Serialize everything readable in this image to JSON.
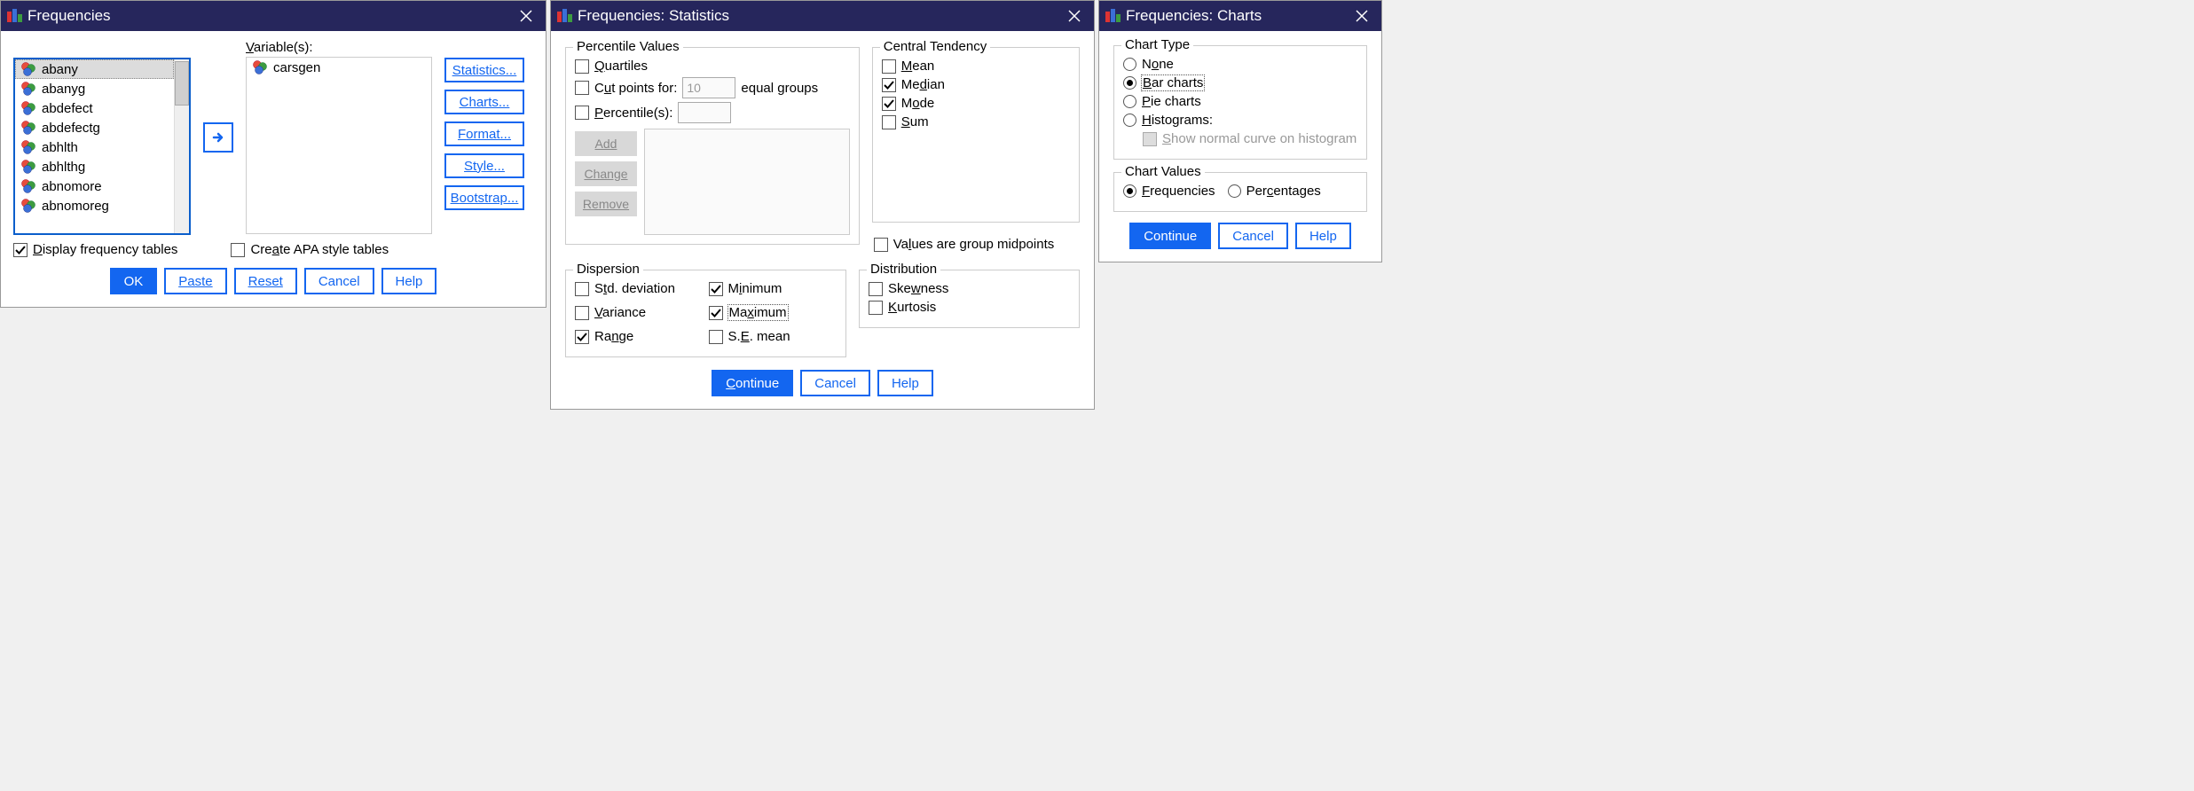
{
  "freq": {
    "title": "Frequencies",
    "vars_label": "Variable(s):",
    "source_vars": [
      "abany",
      "abanyg",
      "abdefect",
      "abdefectg",
      "abhlth",
      "abhlthg",
      "abnomore",
      "abnomoreg"
    ],
    "target_vars": [
      "carsgen"
    ],
    "side_buttons": [
      "Statistics...",
      "Charts...",
      "Format...",
      "Style...",
      "Bootstrap..."
    ],
    "display_ft": "Display frequency tables",
    "create_apa": "Create APA style tables",
    "buttons": {
      "ok": "OK",
      "paste": "Paste",
      "reset": "Reset",
      "cancel": "Cancel",
      "help": "Help"
    }
  },
  "stats": {
    "title": "Frequencies: Statistics",
    "percentile": {
      "legend": "Percentile Values",
      "quartiles": "Quartiles",
      "cutpoints_pre": "Cut points for:",
      "cutpoints_val": "10",
      "cutpoints_post": "equal groups",
      "percentiles": "Percentile(s):",
      "add": "Add",
      "change": "Change",
      "remove": "Remove"
    },
    "central": {
      "legend": "Central Tendency",
      "mean": "Mean",
      "median": "Median",
      "mode": "Mode",
      "sum": "Sum"
    },
    "midpoints": "Values are group midpoints",
    "dispersion": {
      "legend": "Dispersion",
      "std": "Std. deviation",
      "var": "Variance",
      "range": "Range",
      "min": "Minimum",
      "max": "Maximum",
      "se": "S.E. mean"
    },
    "distribution": {
      "legend": "Distribution",
      "skew": "Skewness",
      "kurt": "Kurtosis"
    },
    "buttons": {
      "continue": "Continue",
      "cancel": "Cancel",
      "help": "Help"
    }
  },
  "charts": {
    "title": "Frequencies: Charts",
    "type": {
      "legend": "Chart Type",
      "none": "None",
      "bar": "Bar charts",
      "pie": "Pie charts",
      "hist": "Histograms:",
      "normal": "Show normal curve on histogram"
    },
    "values": {
      "legend": "Chart Values",
      "freq": "Frequencies",
      "perc": "Percentages"
    },
    "buttons": {
      "continue": "Continue",
      "cancel": "Cancel",
      "help": "Help"
    }
  }
}
